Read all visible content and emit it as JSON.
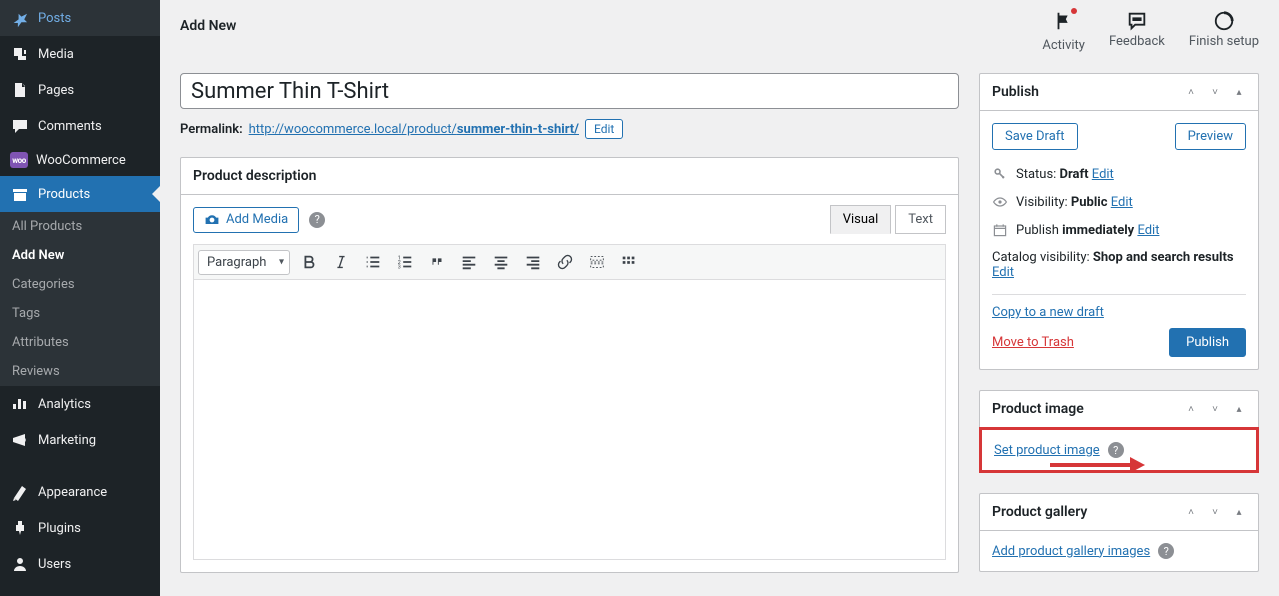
{
  "sidebar": {
    "items": [
      {
        "label": "Posts",
        "icon": "pin"
      },
      {
        "label": "Media",
        "icon": "media"
      },
      {
        "label": "Pages",
        "icon": "pages"
      },
      {
        "label": "Comments",
        "icon": "comment"
      },
      {
        "label": "WooCommerce",
        "icon": "woo"
      },
      {
        "label": "Products",
        "icon": "products"
      },
      {
        "label": "Analytics",
        "icon": "analytics"
      },
      {
        "label": "Marketing",
        "icon": "marketing"
      },
      {
        "label": "Appearance",
        "icon": "appearance"
      },
      {
        "label": "Plugins",
        "icon": "plugins"
      },
      {
        "label": "Users",
        "icon": "users"
      }
    ],
    "products_sub": [
      "All Products",
      "Add New",
      "Categories",
      "Tags",
      "Attributes",
      "Reviews"
    ]
  },
  "top": {
    "title": "Add New",
    "actions": {
      "activity": "Activity",
      "feedback": "Feedback",
      "finish": "Finish setup"
    }
  },
  "product": {
    "title_value": "Summer Thin T-Shirt",
    "permalink_label": "Permalink:",
    "permalink_base": "http://woocommerce.local/product/",
    "permalink_slug": "summer-thin-t-shirt/",
    "edit_btn": "Edit"
  },
  "editor": {
    "box_title": "Product description",
    "add_media": "Add Media",
    "tabs": {
      "visual": "Visual",
      "text": "Text"
    },
    "format_select": "Paragraph"
  },
  "publish": {
    "title": "Publish",
    "save_draft": "Save Draft",
    "preview": "Preview",
    "status_label": "Status: ",
    "status_value": "Draft",
    "visibility_label": "Visibility: ",
    "visibility_value": "Public",
    "publish_label": "Publish ",
    "publish_value": "immediately",
    "catalog_label": "Catalog visibility: ",
    "catalog_value": "Shop and search results",
    "edit": "Edit",
    "copy": "Copy to a new draft",
    "trash": "Move to Trash",
    "publish_btn": "Publish"
  },
  "image_box": {
    "title": "Product image",
    "link": "Set product image"
  },
  "gallery_box": {
    "title": "Product gallery",
    "link": "Add product gallery images"
  }
}
